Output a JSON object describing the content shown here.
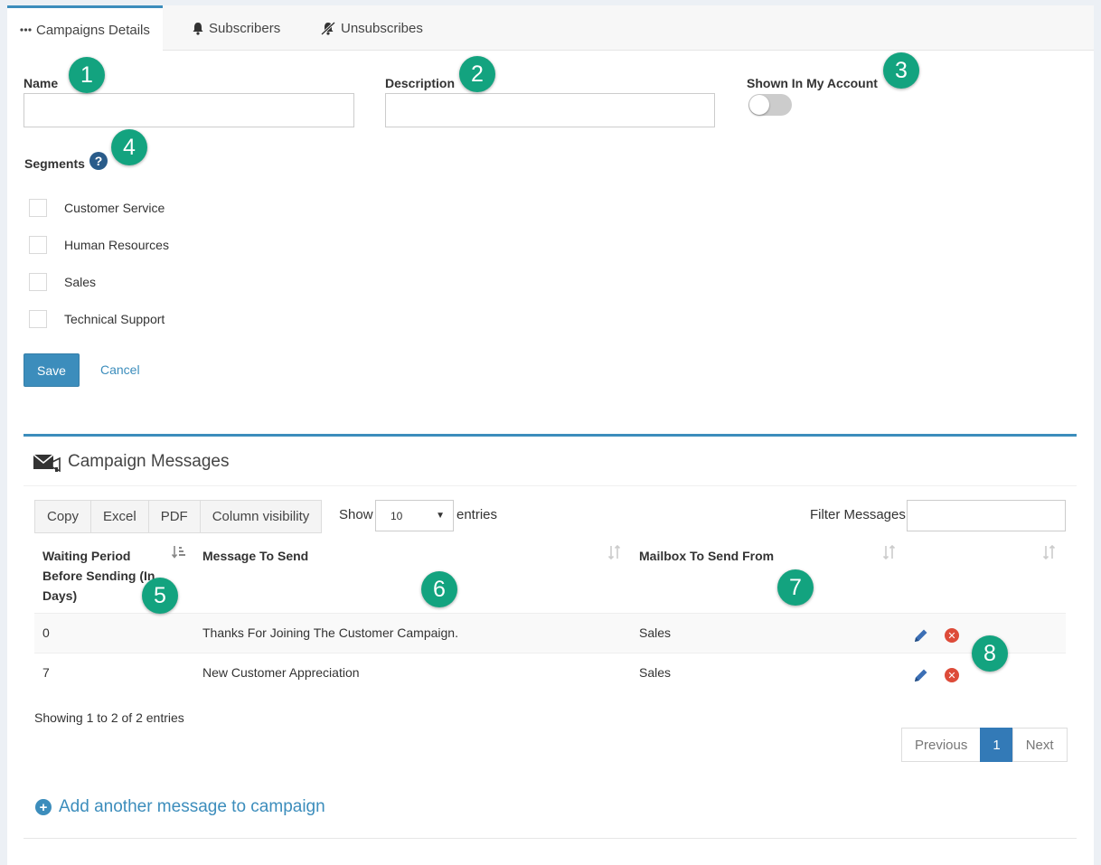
{
  "tabs": [
    {
      "label": "Campaigns Details",
      "icon": "ellipsis-icon"
    },
    {
      "label": "Subscribers",
      "icon": "bell-icon"
    },
    {
      "label": "Unsubscribes",
      "icon": "bell-slash-icon"
    }
  ],
  "form": {
    "name_label": "Name",
    "name_value": "",
    "description_label": "Description",
    "description_value": "",
    "shown_label": "Shown In My Account",
    "shown_on": false,
    "segments_label": "Segments",
    "segments": [
      "Customer Service",
      "Human Resources",
      "Sales",
      "Technical Support"
    ],
    "save_label": "Save",
    "cancel_label": "Cancel"
  },
  "messages": {
    "title": "Campaign Messages",
    "buttons": [
      "Copy",
      "Excel",
      "PDF",
      "Column visibility"
    ],
    "show_label": "Show",
    "page_size": "10",
    "entries_label": "entries",
    "filter_label": "Filter Messages",
    "filter_value": "",
    "columns": [
      "Waiting Period Before Sending (In Days)",
      "Message To Send",
      "Mailbox To Send From"
    ],
    "rows": [
      {
        "waiting": "0",
        "message": "Thanks For Joining The Customer Campaign.",
        "mailbox": "Sales"
      },
      {
        "waiting": "7",
        "message": "New Customer Appreciation",
        "mailbox": "Sales"
      }
    ],
    "info": "Showing 1 to 2 of 2 entries",
    "pagination": {
      "previous": "Previous",
      "current": "1",
      "next": "Next"
    },
    "add_label": "Add another message to campaign"
  },
  "callouts": [
    "1",
    "2",
    "3",
    "4",
    "5",
    "6",
    "7",
    "8"
  ],
  "colors": {
    "accent": "#3c8dbc",
    "callout": "#13a37f",
    "danger": "#dd4b39"
  }
}
